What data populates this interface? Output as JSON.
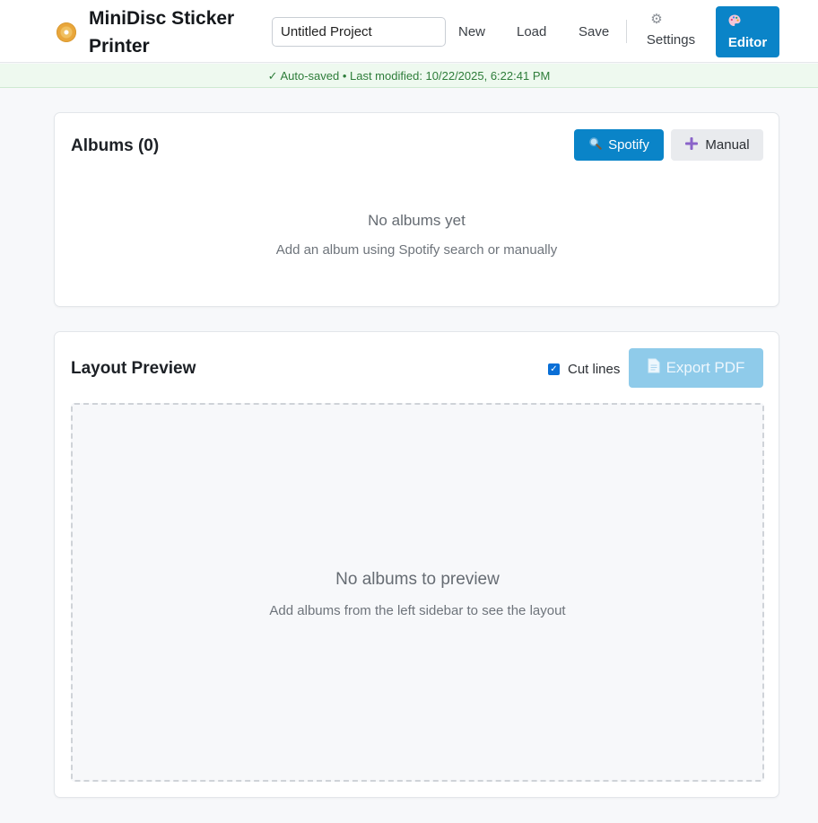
{
  "header": {
    "logo_icon": "minidisc-icon",
    "app_title": "MiniDisc Sticker Printer",
    "project_name": "Untitled Project",
    "nav": {
      "new_label": "New",
      "load_label": "Load",
      "save_label": "Save",
      "settings_label": "Settings",
      "settings_icon": "gear-icon",
      "editor_label": "Editor",
      "editor_icon": "palette-icon"
    }
  },
  "status": {
    "text": "✓ Auto-saved • Last modified: 10/22/2025, 6:22:41 PM"
  },
  "albums": {
    "title": "Albums (0)",
    "spotify_label": "Spotify",
    "spotify_icon": "search-icon",
    "manual_label": "Manual",
    "manual_icon": "plus-icon",
    "empty_title": "No albums yet",
    "empty_subtitle": "Add an album using Spotify search or manually"
  },
  "layout": {
    "title": "Layout Preview",
    "cut_lines_label": "Cut lines",
    "cut_lines_checked": true,
    "export_label": "Export PDF",
    "export_icon": "document-icon",
    "empty_title": "No albums to preview",
    "empty_subtitle": "Add albums from the left sidebar to see the layout"
  },
  "colors": {
    "accent": "#0a84c8",
    "status_bg": "#eef9ef",
    "status_text": "#2e7d3a"
  }
}
